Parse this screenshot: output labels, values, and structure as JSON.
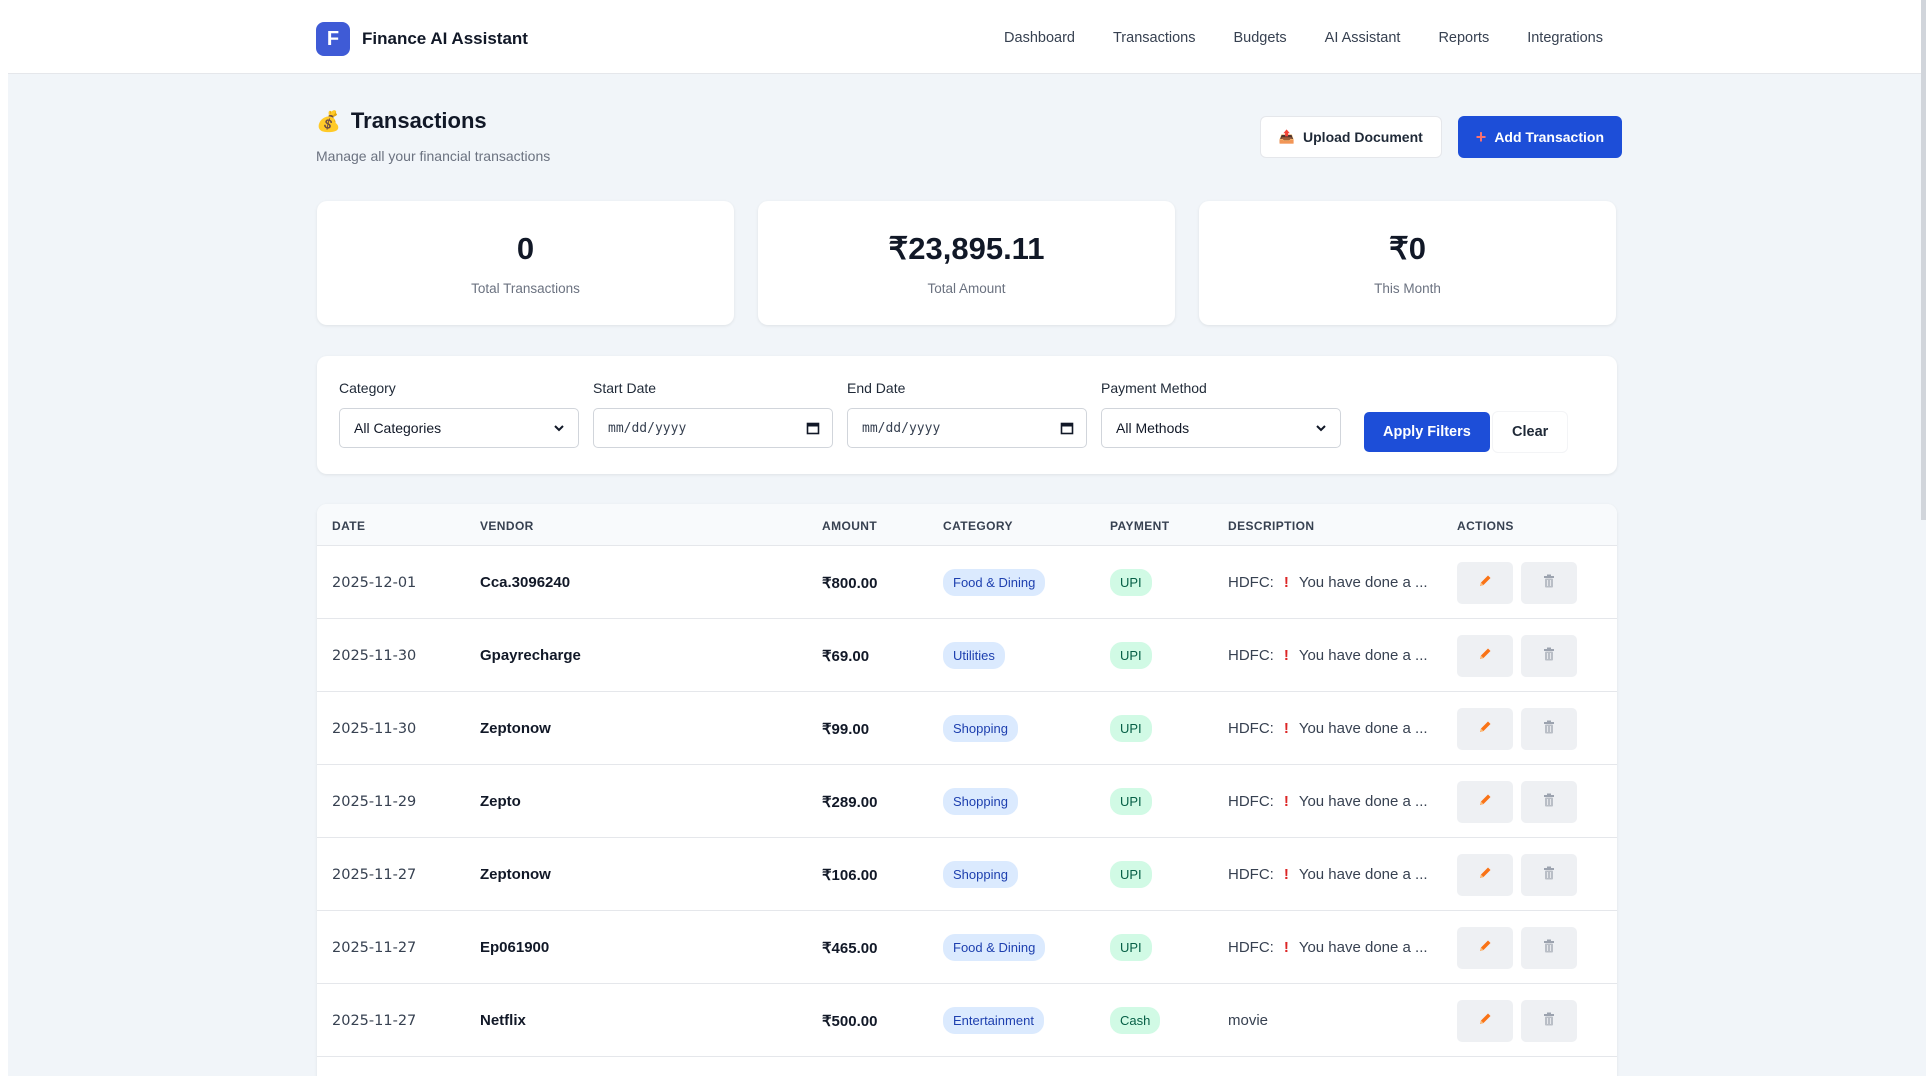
{
  "app": {
    "logo_letter": "F",
    "name": "Finance AI Assistant"
  },
  "nav": {
    "items": [
      "Dashboard",
      "Transactions",
      "Budgets",
      "AI Assistant",
      "Reports",
      "Integrations"
    ]
  },
  "header": {
    "icon": "💰",
    "title": "Transactions",
    "subtitle": "Manage all your financial transactions",
    "upload_icon": "📤",
    "upload_label": "Upload Document",
    "add_icon": "+",
    "add_label": "Add Transaction"
  },
  "stats": [
    {
      "value": "0",
      "label": "Total Transactions"
    },
    {
      "value": "₹23,895.11",
      "label": "Total Amount"
    },
    {
      "value": "₹0",
      "label": "This Month"
    }
  ],
  "filters": {
    "category": {
      "label": "Category",
      "value": "All Categories"
    },
    "start_date": {
      "label": "Start Date",
      "placeholder": "mm/dd/yyyy"
    },
    "end_date": {
      "label": "End Date",
      "placeholder": "mm/dd/yyyy"
    },
    "payment": {
      "label": "Payment Method",
      "value": "All Methods"
    },
    "apply_label": "Apply Filters",
    "clear_label": "Clear"
  },
  "table": {
    "columns": [
      "DATE",
      "VENDOR",
      "AMOUNT",
      "CATEGORY",
      "PAYMENT",
      "DESCRIPTION",
      "ACTIONS"
    ],
    "rows": [
      {
        "date": "2025-12-01",
        "vendor": "Cca.3096240",
        "amount": "₹800.00",
        "category": "Food & Dining",
        "payment": "UPI",
        "desc_prefix": "HDFC:",
        "desc_mark": "!",
        "desc_text": "You have done a ..."
      },
      {
        "date": "2025-11-30",
        "vendor": "Gpayrecharge",
        "amount": "₹69.00",
        "category": "Utilities",
        "payment": "UPI",
        "desc_prefix": "HDFC:",
        "desc_mark": "!",
        "desc_text": "You have done a ..."
      },
      {
        "date": "2025-11-30",
        "vendor": "Zeptonow",
        "amount": "₹99.00",
        "category": "Shopping",
        "payment": "UPI",
        "desc_prefix": "HDFC:",
        "desc_mark": "!",
        "desc_text": "You have done a ..."
      },
      {
        "date": "2025-11-29",
        "vendor": "Zepto",
        "amount": "₹289.00",
        "category": "Shopping",
        "payment": "UPI",
        "desc_prefix": "HDFC:",
        "desc_mark": "!",
        "desc_text": "You have done a ..."
      },
      {
        "date": "2025-11-27",
        "vendor": "Zeptonow",
        "amount": "₹106.00",
        "category": "Shopping",
        "payment": "UPI",
        "desc_prefix": "HDFC:",
        "desc_mark": "!",
        "desc_text": "You have done a ..."
      },
      {
        "date": "2025-11-27",
        "vendor": "Ep061900",
        "amount": "₹465.00",
        "category": "Food & Dining",
        "payment": "UPI",
        "desc_prefix": "HDFC:",
        "desc_mark": "!",
        "desc_text": "You have done a ..."
      },
      {
        "date": "2025-11-27",
        "vendor": "Netflix",
        "amount": "₹500.00",
        "category": "Entertainment",
        "payment": "Cash",
        "desc_prefix": "movie",
        "desc_mark": "",
        "desc_text": ""
      }
    ]
  },
  "icons": {
    "edit": "pencil-icon",
    "delete": "trash-icon"
  },
  "colors": {
    "primary": "#1d4ed8",
    "logo": "#3f5bd6",
    "edit": "#f97316",
    "category_badge": "#dbeafe",
    "payment_badge": "#d1fae5"
  }
}
